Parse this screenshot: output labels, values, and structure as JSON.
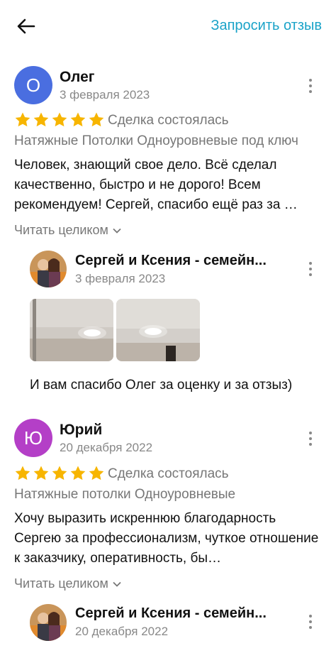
{
  "header": {
    "request_review_label": "Запросить отзыв"
  },
  "reviews": [
    {
      "avatar_letter": "О",
      "avatar_color": "#4a6ee0",
      "author": "Олег",
      "date": "3 февраля 2023",
      "rating": 5,
      "deal_status": "Сделка состоялась",
      "service": "Натяжные Потолки Одноуровневые под ключ",
      "text": "Человек, знающий свое дело. Всё сделал качественно, быстро и не дорого! Всем рекомендуем! Сергей, спасибо ещё раз за …",
      "read_more": "Читать целиком",
      "reply": {
        "author": "Сергей и Ксения - семейн...",
        "date": "3 февраля 2023",
        "text": "И вам спасибо Олег за оценку и за отзыз)"
      }
    },
    {
      "avatar_letter": "Ю",
      "avatar_color": "#b43fc7",
      "author": "Юрий",
      "date": "20 декабря 2022",
      "rating": 5,
      "deal_status": "Сделка состоялась",
      "service": "Натяжные потолки Одноуровневые",
      "text": "Хочу выразить искреннюю благодарность Сергею за профессионализм, чуткое отношение к заказчику, оперативность, бы…",
      "read_more": "Читать целиком",
      "reply": {
        "author": "Сергей и Ксения - семейн...",
        "date": "20 декабря 2022"
      }
    }
  ],
  "colors": {
    "accent": "#1aa3c8",
    "star": "#f7b500",
    "muted": "#777777"
  }
}
